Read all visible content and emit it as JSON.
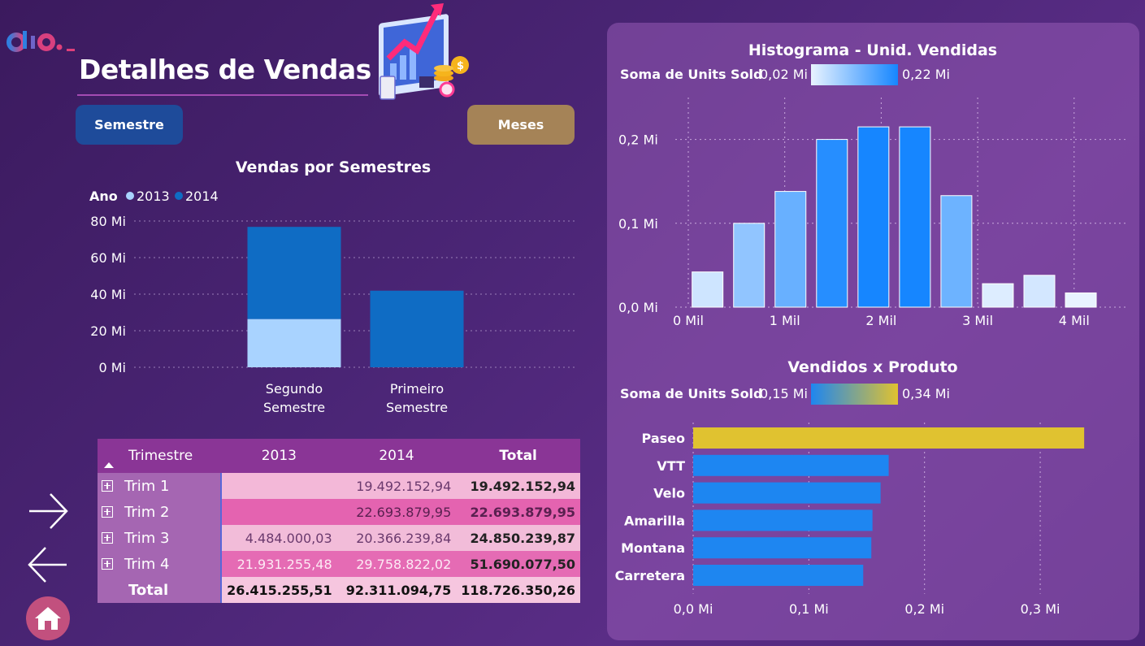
{
  "header": {
    "title": "Detalhes de Vendas",
    "logo_text": "dio"
  },
  "buttons": {
    "semestre": "Semestre",
    "meses": "Meses"
  },
  "colors": {
    "year_2013": "#a9d3ff",
    "year_2014": "#0f6cc4",
    "hist_low": "#e9f3ff",
    "hist_high": "#1686ff",
    "prod_low": "#1e86f0",
    "prod_high": "#e0c230",
    "semestre_button": "#1e4b9a",
    "meses_button": "#a58357"
  },
  "chart_data": [
    {
      "id": "semestres",
      "type": "bar",
      "title": "Vendas por Semestres",
      "legend_title": "Ano",
      "categories": [
        "Segundo Semestre",
        "Primeiro Semestre"
      ],
      "series": [
        {
          "name": "2013",
          "values": [
            26.4,
            0
          ]
        },
        {
          "name": "2014",
          "values": [
            50.4,
            41.9
          ]
        }
      ],
      "stacked": true,
      "yticks": [
        "0 Mi",
        "20 Mi",
        "40 Mi",
        "60 Mi",
        "80 Mi"
      ],
      "ylim": [
        0,
        80
      ],
      "grid": true,
      "legend_position": "top-left"
    },
    {
      "id": "histograma",
      "type": "bar",
      "title": "Histograma - Unid. Vendidas",
      "legend_label": "Soma de Units Sold",
      "legend_min": "0,02 Mi",
      "legend_max": "0,22 Mi",
      "x": [
        250,
        680,
        1110,
        1540,
        1970,
        2400,
        2830,
        3260,
        3690,
        4120
      ],
      "values": [
        0.042,
        0.1,
        0.138,
        0.2,
        0.215,
        0.215,
        0.133,
        0.028,
        0.038,
        0.017
      ],
      "xticks": [
        "0 Mil",
        "1 Mil",
        "2 Mil",
        "3 Mil",
        "4 Mil"
      ],
      "yticks": [
        "0,0 Mi",
        "0,1 Mi",
        "0,2 Mi"
      ],
      "ylim": [
        0,
        0.25
      ],
      "xlim": [
        0,
        4600
      ],
      "grid": true
    },
    {
      "id": "produtos",
      "type": "bar",
      "orientation": "horizontal",
      "title": "Vendidos x Produto",
      "legend_label": "Soma de Units Sold",
      "legend_min": "0,15 Mi",
      "legend_max": "0,34 Mi",
      "categories": [
        "Paseo",
        "VTT",
        "Velo",
        "Amarilla",
        "Montana",
        "Carretera"
      ],
      "values": [
        0.338,
        0.169,
        0.162,
        0.155,
        0.154,
        0.147
      ],
      "xticks": [
        "0,0 Mi",
        "0,1 Mi",
        "0,2 Mi",
        "0,3 Mi"
      ],
      "xlim": [
        0,
        0.34
      ],
      "grid": true
    },
    {
      "id": "matriz",
      "type": "table",
      "columns": [
        "Trimestre",
        "2013",
        "2014",
        "Total"
      ],
      "rows": [
        {
          "label": "Trim 1",
          "y2013": "",
          "y2014": "19.492.152,94",
          "total": "19.492.152,94"
        },
        {
          "label": "Trim 2",
          "y2013": "",
          "y2014": "22.693.879,95",
          "total": "22.693.879,95"
        },
        {
          "label": "Trim 3",
          "y2013": "4.484.000,03",
          "y2014": "20.366.239,84",
          "total": "24.850.239,87"
        },
        {
          "label": "Trim 4",
          "y2013": "21.931.255,48",
          "y2014": "29.758.822,02",
          "total": "51.690.077,50"
        }
      ],
      "total_row": {
        "label": "Total",
        "y2013": "26.415.255,51",
        "y2014": "92.311.094,75",
        "total": "118.726.350,26"
      }
    }
  ]
}
